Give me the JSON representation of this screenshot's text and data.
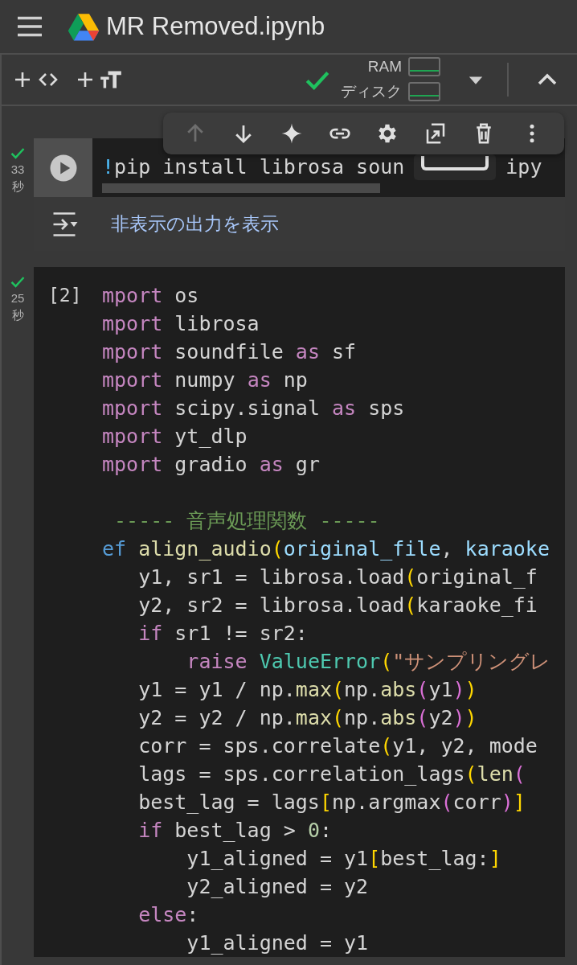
{
  "header": {
    "title": "MR Removed.ipynb"
  },
  "toolbar": {
    "connected": true,
    "resources": [
      {
        "label": "RAM"
      },
      {
        "label": "ディスク"
      }
    ]
  },
  "cell_toolbar": [
    {
      "kind": "up",
      "disabled": true
    },
    {
      "kind": "down",
      "disabled": false
    },
    {
      "kind": "sparkle",
      "disabled": false
    },
    {
      "kind": "link",
      "disabled": false
    },
    {
      "kind": "gear",
      "disabled": false
    },
    {
      "kind": "mirror",
      "disabled": false
    },
    {
      "kind": "trash",
      "disabled": false
    },
    {
      "kind": "more",
      "disabled": false
    }
  ],
  "cells": [
    {
      "kind": "run",
      "done": true,
      "time": "33",
      "unit": "秒",
      "lines": [
        {
          "tokens": [
            {
              "kind": "bang",
              "text": "!"
            },
            {
              "kind": "plain",
              "text": "pip install librosa soun"
            }
          ]
        }
      ],
      "tail": "ipy",
      "output_toggle": "非表示の出力を表示"
    },
    {
      "kind": "count",
      "done": true,
      "time": "25",
      "unit": "秒",
      "count": "[2]",
      "lines": [
        {
          "tokens": [
            {
              "kind": "kw",
              "text": "mport"
            },
            {
              "kind": "plain",
              "text": " os"
            }
          ]
        },
        {
          "tokens": [
            {
              "kind": "kw",
              "text": "mport"
            },
            {
              "kind": "plain",
              "text": " librosa"
            }
          ]
        },
        {
          "tokens": [
            {
              "kind": "kw",
              "text": "mport"
            },
            {
              "kind": "plain",
              "text": " soundfile "
            },
            {
              "kind": "kw",
              "text": "as"
            },
            {
              "kind": "plain",
              "text": " sf"
            }
          ]
        },
        {
          "tokens": [
            {
              "kind": "kw",
              "text": "mport"
            },
            {
              "kind": "plain",
              "text": " numpy "
            },
            {
              "kind": "kw",
              "text": "as"
            },
            {
              "kind": "plain",
              "text": " np"
            }
          ]
        },
        {
          "tokens": [
            {
              "kind": "kw",
              "text": "mport"
            },
            {
              "kind": "plain",
              "text": " scipy.signal "
            },
            {
              "kind": "kw",
              "text": "as"
            },
            {
              "kind": "plain",
              "text": " sps"
            }
          ]
        },
        {
          "tokens": [
            {
              "kind": "kw",
              "text": "mport"
            },
            {
              "kind": "plain",
              "text": " yt_dlp"
            }
          ]
        },
        {
          "tokens": [
            {
              "kind": "kw",
              "text": "mport"
            },
            {
              "kind": "plain",
              "text": " gradio "
            },
            {
              "kind": "kw",
              "text": "as"
            },
            {
              "kind": "plain",
              "text": " gr"
            }
          ]
        },
        {
          "blank_before": true,
          "tokens": [
            {
              "kind": "cmt",
              "text": " ----- 音声処理関数 -----"
            }
          ]
        },
        {
          "tokens": [
            {
              "kind": "def",
              "text": "ef"
            },
            {
              "kind": "fn",
              "text": " align_audio"
            },
            {
              "kind": "b1",
              "text": "("
            },
            {
              "kind": "param",
              "text": "original_file"
            },
            {
              "kind": "plain",
              "text": ", "
            },
            {
              "kind": "param",
              "text": "karaoke"
            }
          ]
        },
        {
          "tokens": [
            {
              "kind": "plain",
              "text": "   y1, sr1 = librosa.load"
            },
            {
              "kind": "b1",
              "text": "("
            },
            {
              "kind": "plain",
              "text": "original_f"
            }
          ]
        },
        {
          "tokens": [
            {
              "kind": "plain",
              "text": "   y2, sr2 = librosa.load"
            },
            {
              "kind": "b1",
              "text": "("
            },
            {
              "kind": "plain",
              "text": "karaoke_fi"
            }
          ]
        },
        {
          "tokens": [
            {
              "kind": "kw",
              "text": "   if"
            },
            {
              "kind": "plain",
              "text": " sr1 != sr2:"
            }
          ]
        },
        {
          "tokens": [
            {
              "kind": "kw",
              "text": "       raise"
            },
            {
              "kind": "cls",
              "text": " ValueError"
            },
            {
              "kind": "b1",
              "text": "("
            },
            {
              "kind": "str",
              "text": "\"サンプリングレ"
            }
          ]
        },
        {
          "tokens": [
            {
              "kind": "plain",
              "text": "   y1 = y1 / np."
            },
            {
              "kind": "fn",
              "text": "max"
            },
            {
              "kind": "b1",
              "text": "("
            },
            {
              "kind": "plain",
              "text": "np."
            },
            {
              "kind": "fn",
              "text": "abs"
            },
            {
              "kind": "b2",
              "text": "("
            },
            {
              "kind": "plain",
              "text": "y1"
            },
            {
              "kind": "b2",
              "text": ")"
            },
            {
              "kind": "b1",
              "text": ")"
            }
          ]
        },
        {
          "tokens": [
            {
              "kind": "plain",
              "text": "   y2 = y2 / np."
            },
            {
              "kind": "fn",
              "text": "max"
            },
            {
              "kind": "b1",
              "text": "("
            },
            {
              "kind": "plain",
              "text": "np."
            },
            {
              "kind": "fn",
              "text": "abs"
            },
            {
              "kind": "b2",
              "text": "("
            },
            {
              "kind": "plain",
              "text": "y2"
            },
            {
              "kind": "b2",
              "text": ")"
            },
            {
              "kind": "b1",
              "text": ")"
            }
          ]
        },
        {
          "tokens": [
            {
              "kind": "plain",
              "text": "   corr = sps.correlate"
            },
            {
              "kind": "b1",
              "text": "("
            },
            {
              "kind": "plain",
              "text": "y1, y2, mode"
            }
          ]
        },
        {
          "tokens": [
            {
              "kind": "plain",
              "text": "   lags = sps.correlation_lags"
            },
            {
              "kind": "b1",
              "text": "("
            },
            {
              "kind": "fn",
              "text": "len"
            },
            {
              "kind": "b2",
              "text": "("
            }
          ]
        },
        {
          "tokens": [
            {
              "kind": "plain",
              "text": "   best_lag = lags"
            },
            {
              "kind": "b1",
              "text": "["
            },
            {
              "kind": "plain",
              "text": "np.argmax"
            },
            {
              "kind": "b2",
              "text": "("
            },
            {
              "kind": "plain",
              "text": "corr"
            },
            {
              "kind": "b2",
              "text": ")"
            },
            {
              "kind": "b1",
              "text": "]"
            }
          ]
        },
        {
          "tokens": [
            {
              "kind": "kw",
              "text": "   if"
            },
            {
              "kind": "plain",
              "text": " best_lag > "
            },
            {
              "kind": "num",
              "text": "0"
            },
            {
              "kind": "plain",
              "text": ":"
            }
          ]
        },
        {
          "tokens": [
            {
              "kind": "plain",
              "text": "       y1_aligned = y1"
            },
            {
              "kind": "b1",
              "text": "["
            },
            {
              "kind": "plain",
              "text": "best_lag:"
            },
            {
              "kind": "b1",
              "text": "]"
            }
          ]
        },
        {
          "tokens": [
            {
              "kind": "plain",
              "text": "       y2_aligned = y2"
            }
          ]
        },
        {
          "tokens": [
            {
              "kind": "kw",
              "text": "   else"
            },
            {
              "kind": "plain",
              "text": ":"
            }
          ]
        },
        {
          "tokens": [
            {
              "kind": "plain",
              "text": "       y1_aligned = y1"
            }
          ]
        }
      ]
    }
  ]
}
